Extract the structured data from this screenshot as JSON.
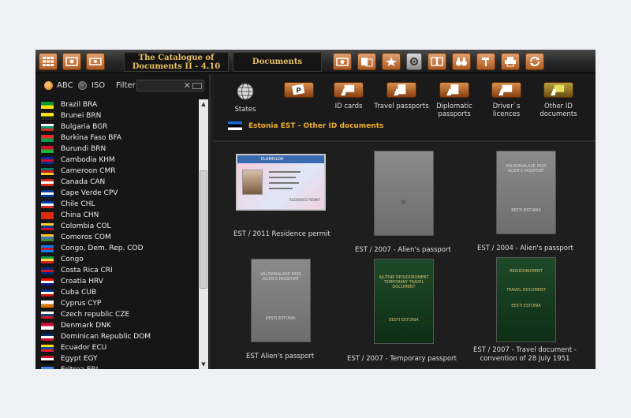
{
  "app": {
    "title_line1": "The Catalogue of",
    "title_line2": "Documents II - 4.10",
    "section": "Documents"
  },
  "filter": {
    "abc_label": "ABC",
    "iso_label": "ISO",
    "filter_label": "Filter",
    "value": "",
    "clear": "✕"
  },
  "countries": [
    {
      "name": "Brazil BRA",
      "flag": [
        "#009b3a",
        "#fedf00"
      ]
    },
    {
      "name": "Brunei BRN",
      "flag": [
        "#f7e017",
        "#222222"
      ]
    },
    {
      "name": "Bulgaria BGR",
      "flag": [
        "#ffffff",
        "#00966e",
        "#d62612"
      ]
    },
    {
      "name": "Burkina Faso BFA",
      "flag": [
        "#ef2b2d",
        "#009e49"
      ]
    },
    {
      "name": "Burundi BRN",
      "flag": [
        "#ce1126",
        "#1eb53a"
      ]
    },
    {
      "name": "Cambodia KHM",
      "flag": [
        "#032ea1",
        "#e00025",
        "#032ea1"
      ]
    },
    {
      "name": "Cameroon CMR",
      "flag": [
        "#007a5e",
        "#ce1126",
        "#fcd116"
      ]
    },
    {
      "name": "Canada CAN",
      "flag": [
        "#d52b1e",
        "#ffffff",
        "#d52b1e"
      ]
    },
    {
      "name": "Cape Verde CPV",
      "flag": [
        "#003893",
        "#ffffff",
        "#003893"
      ]
    },
    {
      "name": "Chile CHL",
      "flag": [
        "#0039a6",
        "#ffffff",
        "#d52b1e"
      ]
    },
    {
      "name": "China CHN",
      "flag": [
        "#de2910",
        "#de2910"
      ]
    },
    {
      "name": "Colombia COL",
      "flag": [
        "#fcd116",
        "#003893",
        "#ce1126"
      ]
    },
    {
      "name": "Comoros COM",
      "flag": [
        "#ffc61e",
        "#3a75c4",
        "#3d8e33"
      ]
    },
    {
      "name": "Congo, Dem. Rep. COD",
      "flag": [
        "#007fff",
        "#ce1021",
        "#007fff"
      ]
    },
    {
      "name": "Congo",
      "flag": [
        "#009543",
        "#fbde4a",
        "#dc241f"
      ]
    },
    {
      "name": "Costa Rica CRI",
      "flag": [
        "#002b7f",
        "#ce1126",
        "#002b7f"
      ]
    },
    {
      "name": "Croatia HRV",
      "flag": [
        "#ff0000",
        "#ffffff",
        "#171796"
      ]
    },
    {
      "name": "Cuba CUB",
      "flag": [
        "#002a8f",
        "#ffffff",
        "#cb1515"
      ]
    },
    {
      "name": "Cyprus CYP",
      "flag": [
        "#ffffff",
        "#d57800"
      ]
    },
    {
      "name": "Czech republic CZE",
      "flag": [
        "#ffffff",
        "#11457e",
        "#d7141a"
      ]
    },
    {
      "name": "Denmark DNK",
      "flag": [
        "#c60c30",
        "#ffffff"
      ]
    },
    {
      "name": "Dominican Republic DOM",
      "flag": [
        "#002d62",
        "#ffffff",
        "#ce1126"
      ]
    },
    {
      "name": "Ecuador ECU",
      "flag": [
        "#ffdd00",
        "#034ea2",
        "#ed1c24"
      ]
    },
    {
      "name": "Egypt EGY",
      "flag": [
        "#ce1126",
        "#ffffff",
        "#000000"
      ]
    },
    {
      "name": "Eritrea ERI",
      "flag": [
        "#4189dd",
        "#12ad2b"
      ]
    }
  ],
  "categories": [
    {
      "label": "States",
      "icon": "globe-icon"
    },
    {
      "label": "",
      "icon": "parking-icon"
    },
    {
      "label": "ID cards",
      "icon": "id-card-icon"
    },
    {
      "label": "Travel passports",
      "icon": "travel-passport-icon"
    },
    {
      "label": "Diplomatic passports",
      "icon": "diplomatic-passport-icon"
    },
    {
      "label": "Driver`s licences",
      "icon": "driver-licence-icon"
    },
    {
      "label": "Other ID documents",
      "icon": "other-id-icon"
    }
  ],
  "breadcrumb": "Estonia EST - Other ID documents",
  "documents": [
    {
      "caption": "EST / 2011 Residence permit",
      "cover_title": "ELAMISLOA",
      "cover_sub": "RESIDENCE PERMIT",
      "cover_bottom": ""
    },
    {
      "caption": "EST / 2007 - Alien's passport",
      "cover_title": "",
      "cover_sub": "",
      "cover_bottom": ""
    },
    {
      "caption": "EST / 2004 - Alien's passport",
      "cover_title": "VÄLISMAALASE PASS",
      "cover_sub": "ALIEN'S PASSPORT",
      "cover_bottom": "EESTI ESTONIA"
    },
    {
      "caption": "EST Alien's passport",
      "cover_title": "VÄLISMAALASE PASS",
      "cover_sub": "ALIEN'S PASSPORT",
      "cover_bottom": "EESTI ESTONIA"
    },
    {
      "caption": "EST / 2007 - Temporary passport",
      "cover_title": "AJUTINE REISIDOKUMENT",
      "cover_sub": "TEMPORARY TRAVEL DOCUMENT",
      "cover_bottom": "EESTI ESTONIA"
    },
    {
      "caption_line1": "EST / 2007 - Travel document -",
      "caption_line2": "convention of 28 July 1951",
      "cover_title": "REISIDOKUMENT",
      "cover_sub": "TRAVEL DOCUMENT",
      "cover_bottom": "EESTI ESTONIA"
    }
  ]
}
